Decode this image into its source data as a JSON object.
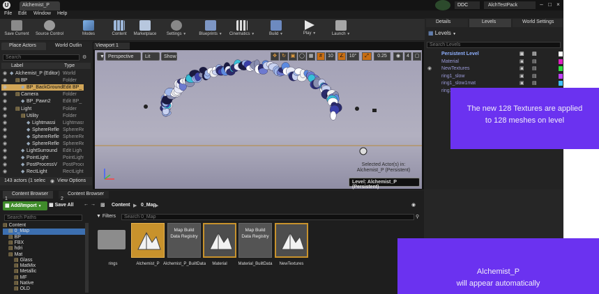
{
  "title_bar": {
    "document_tab": "Alchemist_P",
    "ddc_label": "DDC",
    "project_name": "AlchTestPack"
  },
  "menu": [
    "File",
    "Edit",
    "Window",
    "Help"
  ],
  "toolbar": [
    {
      "label": "Save Current",
      "icon": "save-icon"
    },
    {
      "label": "Source Control",
      "icon": "source-control-icon"
    },
    {
      "label": "Modes",
      "icon": "modes-icon"
    },
    {
      "label": "Content",
      "icon": "content-icon"
    },
    {
      "label": "Marketplace",
      "icon": "marketplace-icon"
    },
    {
      "label": "Settings",
      "icon": "settings-icon"
    },
    {
      "label": "Blueprints",
      "icon": "blueprints-icon"
    },
    {
      "label": "Cinematics",
      "icon": "cinematics-icon"
    },
    {
      "label": "Build",
      "icon": "build-icon"
    },
    {
      "label": "Play",
      "icon": "play-icon"
    },
    {
      "label": "Launch",
      "icon": "launch-icon"
    }
  ],
  "left_panel": {
    "tabs": [
      "Place Actors",
      "World Outlin"
    ],
    "search_placeholder": "Search",
    "col_label": "Label",
    "col_type": "Type",
    "rows": [
      {
        "label": "Alchemist_P (Editor)",
        "type": "World",
        "indent": 0
      },
      {
        "label": "BP",
        "type": "Folder",
        "indent": 1
      },
      {
        "label": "BP_BackGround",
        "type": "Edit BP_",
        "indent": 2,
        "selected": true
      },
      {
        "label": "Camera",
        "type": "Folder",
        "indent": 1
      },
      {
        "label": "BP_Pawn2",
        "type": "Edit BP_",
        "indent": 2
      },
      {
        "label": "Light",
        "type": "Folder",
        "indent": 1
      },
      {
        "label": "Utility",
        "type": "Folder",
        "indent": 2
      },
      {
        "label": "Lightmassi",
        "type": "Lightmass",
        "indent": 3
      },
      {
        "label": "SphereRefle",
        "type": "SphereRef",
        "indent": 3
      },
      {
        "label": "SphereRefle",
        "type": "SphereRef",
        "indent": 3
      },
      {
        "label": "SphereRefle",
        "type": "SphereRef",
        "indent": 3
      },
      {
        "label": "LightSurround",
        "type": "Edit Ligh",
        "indent": 2
      },
      {
        "label": "PointLight",
        "type": "PointLight",
        "indent": 2
      },
      {
        "label": "PostProcessV",
        "type": "PostProce",
        "indent": 2
      },
      {
        "label": "RectLight",
        "type": "RectLight",
        "indent": 2
      }
    ],
    "actors_count": "143 actors (1 selec",
    "view_options": "View Options"
  },
  "viewport": {
    "tab": "Viewport 1",
    "perspective": "Perspective",
    "lit": "Lit",
    "show": "Show",
    "snap_angle": "10°",
    "snap_grid": "10",
    "scale": "0.25",
    "camera_speed": "4",
    "selected_note_line1": "Selected Actor(s) in:",
    "selected_note_line2": "Alchemist_P (Persistent)",
    "level_label": "Level:  Alchemist_P (Persistent)"
  },
  "right_panel": {
    "tabs": [
      "Details",
      "Levels",
      "World Settings"
    ],
    "levels_button": "Levels",
    "search_placeholder": "Search Levels",
    "rows": [
      {
        "name": "Persistent Level",
        "color": "#ffffff"
      },
      {
        "name": "Material",
        "color": "#e020c0"
      },
      {
        "name": "NewTextures",
        "color": "#30e040"
      },
      {
        "name": "ring1_slow",
        "color": "#c040ff"
      },
      {
        "name": "ring1_slow1mat",
        "color": "#40c0ff"
      },
      {
        "name": "ring1_still",
        "color": "#30d030"
      }
    ]
  },
  "content_browser": {
    "tabs": [
      "Content Browser 1",
      "Content Browser 2"
    ],
    "add_import": "Add/Import",
    "save_all": "Save All",
    "path": [
      "Content",
      "0_Map"
    ],
    "filters": "Filters",
    "search_placeholder": "Search 0_Map",
    "tree_search_placeholder": "Search Paths",
    "tree": [
      {
        "label": "Content",
        "indent": 0
      },
      {
        "label": "0_Map",
        "indent": 1,
        "selected": true
      },
      {
        "label": "BP",
        "indent": 1
      },
      {
        "label": "FBX",
        "indent": 1
      },
      {
        "label": "hdri",
        "indent": 1
      },
      {
        "label": "Mat",
        "indent": 1
      },
      {
        "label": "Glass",
        "indent": 2
      },
      {
        "label": "MatMix",
        "indent": 2
      },
      {
        "label": "Metallic",
        "indent": 2
      },
      {
        "label": "MF",
        "indent": 2
      },
      {
        "label": "Native",
        "indent": 2
      },
      {
        "label": "OLD",
        "indent": 2
      }
    ],
    "assets": [
      {
        "name": "rings",
        "kind": "folder"
      },
      {
        "name": "Alchemist_P",
        "kind": "map",
        "selected": true
      },
      {
        "name": "Alchemist_P_BuiltData",
        "kind": "data",
        "thumb": "Map Build Data Registry"
      },
      {
        "name": "Material",
        "kind": "map"
      },
      {
        "name": "Material_BuiltData",
        "kind": "data",
        "thumb": "Map Build Data Registry"
      },
      {
        "name": "NewTextures",
        "kind": "map"
      }
    ]
  },
  "callouts": {
    "textures_line1": "The new 128 Textures are applied",
    "textures_line2": "to 128 meshes on level",
    "alchemist_line1": "Alchemist_P",
    "alchemist_line2": "will appear automatically"
  },
  "colors": {
    "accent": "#c86e14",
    "callout": "#6b32f0",
    "selection": "#d2a657"
  }
}
